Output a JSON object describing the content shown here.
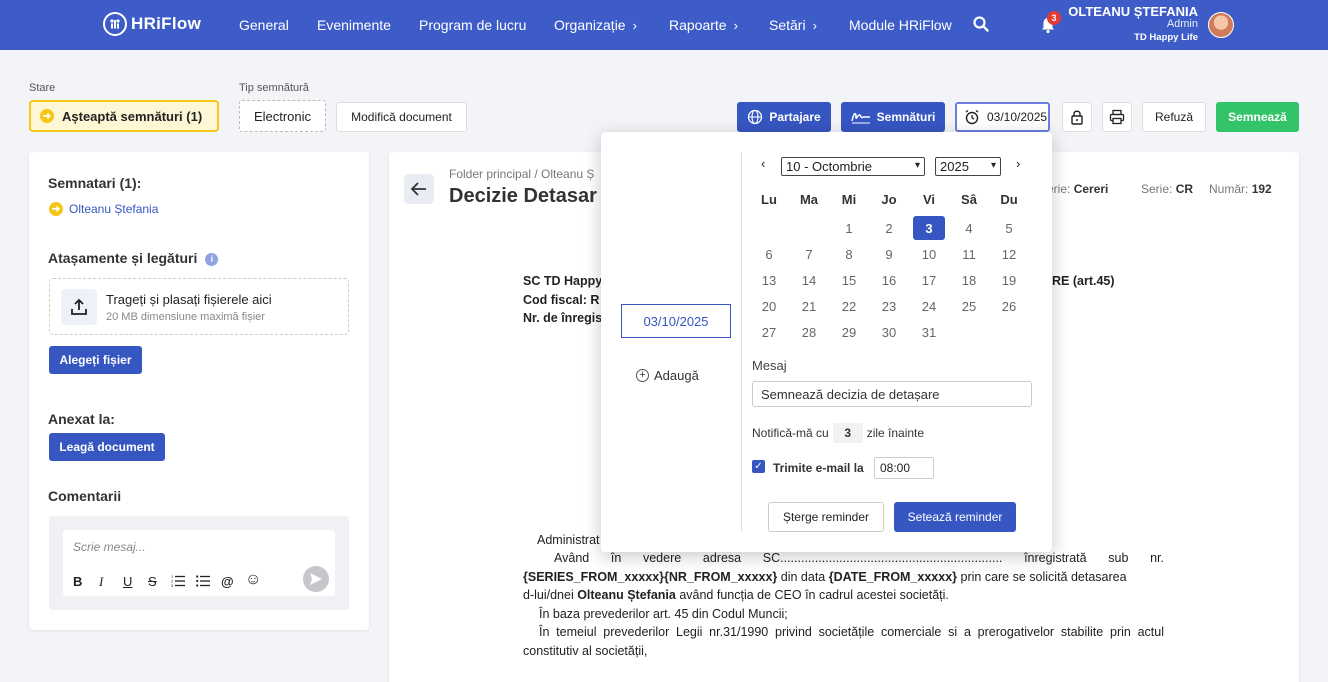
{
  "app": {
    "name": "HRiFlow",
    "logo_mark": "ꀠ"
  },
  "nav": {
    "items": [
      {
        "label": "General",
        "chev": ""
      },
      {
        "label": "Evenimente",
        "chev": ""
      },
      {
        "label": "Program de lucru",
        "chev": ""
      },
      {
        "label": "Organizație",
        "chev": "›"
      },
      {
        "label": "Rapoarte",
        "chev": "›"
      },
      {
        "label": "Setări",
        "chev": "›"
      },
      {
        "label": "Module HRiFlow",
        "chev": ""
      }
    ],
    "notifications": "3"
  },
  "user": {
    "name": "OLTEANU ȘTEFANIA",
    "role": "Admin",
    "company": "TD Happy Life"
  },
  "toolbar": {
    "stare_label": "Stare",
    "stare_value": "Așteaptă semnături (1)",
    "tip_label": "Tip semnătură",
    "tip_value": "Electronic",
    "modify": "Modifică document",
    "share": "Partajare",
    "signatures": "Semnături",
    "date": "03/10/2025",
    "refuse": "Refuză",
    "sign": "Semnează"
  },
  "left": {
    "signers_title": "Semnatari (1):",
    "signer": "Olteanu Ștefania",
    "attach_title": "Atașamente și legături",
    "drop_title": "Trageți și plasați fișierele aici",
    "drop_sub": "20 MB dimensiune maximă fișier",
    "choose_file": "Alegeți fișier",
    "annex_title": "Anexat la:",
    "link_doc": "Leagă document",
    "comments_title": "Comentarii",
    "comment_placeholder": "Scrie mesaj..."
  },
  "doc": {
    "breadcrumb": "Folder principal / Olteanu Ș",
    "title": "Decizie Detasar",
    "register_label": "serie:",
    "register_value": "Cereri",
    "series_label": "Serie:",
    "series_value": "CR",
    "number_label": "Număr:",
    "number_value": "192",
    "company": "SC TD Happy",
    "cod": "Cod fiscal: R",
    "nr": "Nr. de înregis",
    "right_header": "RE (art.45)",
    "admin": "Administrat",
    "p1_a": "Având în vedere adresa SC................................................................ înregistrată sub nr.",
    "p1_b1": "{SERIES_FROM_xxxxx}{NR_FROM_xxxxx}",
    "p1_b2": " din data ",
    "p1_b3": "{DATE_FROM_xxxxx}",
    "p1_b4": "  prin care se solicită detasarea",
    "p1_c1": "d-lui/dnei ",
    "p1_c2": "Olteanu Ștefania",
    "p1_c3": " având funcția de CEO în cadrul acestei societăți.",
    "p2": "În baza prevederilor art. 45 din Codul Muncii;",
    "p3_a": "În temeiul prevederilor Legii nr.31/1990 privind societățile comerciale si a prerogativelor stabilite prin actul",
    "p3_b": "constitutiv al societății,"
  },
  "popup": {
    "date": "03/10/2025",
    "add": "Adaugă",
    "month": "10 - Octombrie",
    "year": "2025",
    "weekdays": [
      "Lu",
      "Ma",
      "Mi",
      "Jo",
      "Vi",
      "Sâ",
      "Du"
    ],
    "days": [
      "1",
      "2",
      "3",
      "4",
      "5",
      "6",
      "7",
      "8",
      "9",
      "10",
      "11",
      "12",
      "13",
      "14",
      "15",
      "16",
      "17",
      "18",
      "19",
      "20",
      "21",
      "22",
      "23",
      "24",
      "25",
      "26",
      "27",
      "28",
      "29",
      "30",
      "31"
    ],
    "selected_day": "3",
    "message_label": "Mesaj",
    "message_value": "Semnează decizia de detașare",
    "notify_prefix": "Notifică-mă cu",
    "notify_days": "3",
    "notify_suffix": "zile înainte",
    "email_label": "Trimite e-mail la",
    "email_time": "08:00",
    "delete": "Șterge reminder",
    "set": "Setează reminder"
  },
  "colors": {
    "primary": "#3d5cc7",
    "accent_blue": "#3656c2",
    "success": "#33c46a",
    "warning": "#f5c518",
    "danger": "#e53935"
  }
}
